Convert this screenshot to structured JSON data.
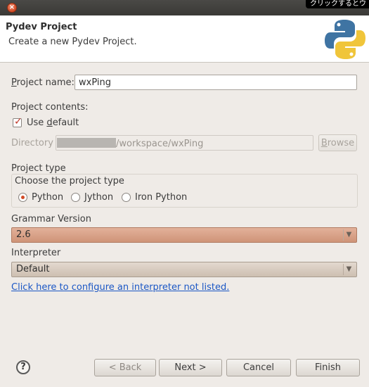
{
  "titlebar": {
    "close_glyph": "×",
    "overlay_text": "クリックするとウ"
  },
  "header": {
    "title": "Pydev Project",
    "description": "Create a new Pydev Project.",
    "logo_icon": "python-logo-icon"
  },
  "project_name": {
    "label_mnemonic": "P",
    "label_rest": "roject name:",
    "value": "wxPing"
  },
  "project_contents": {
    "label": "Project contents:",
    "use_default": {
      "pre": "Use ",
      "mnemonic": "d",
      "post": "efault",
      "checked": true
    },
    "directory_label": "Directory",
    "directory_value": "/workspace/wxPing",
    "browse_mnemonic": "B",
    "browse_rest": "rowse"
  },
  "project_type": {
    "label": "Project type",
    "group_label": "Choose the project type",
    "options": [
      "Python",
      "Jython",
      "Iron Python"
    ],
    "selected": "Python"
  },
  "grammar": {
    "label": "Grammar Version",
    "value": "2.6"
  },
  "interpreter": {
    "label": "Interpreter",
    "value": "Default",
    "configure_link": "Click here to configure an interpreter not listed."
  },
  "footer": {
    "help_icon": "help-question-icon",
    "help_glyph": "?",
    "back": "< Back",
    "next": "Next >",
    "cancel": "Cancel",
    "finish": "Finish"
  },
  "colors": {
    "accent_red": "#d24a25",
    "link": "#1b57c5",
    "grammar_combo": "#d9a286"
  }
}
